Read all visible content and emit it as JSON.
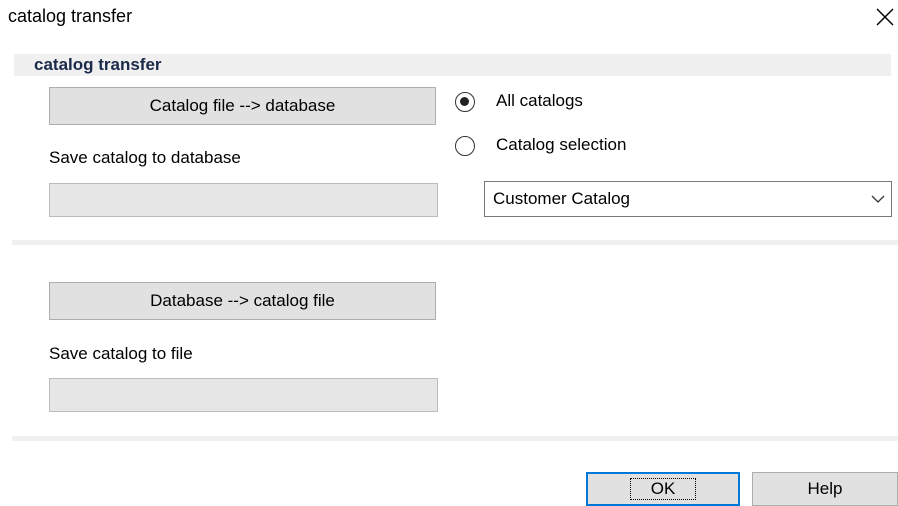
{
  "window": {
    "title": "catalog transfer"
  },
  "group": {
    "label": "catalog transfer"
  },
  "import_section": {
    "button_label": "Catalog file --> database",
    "status_label": "Save catalog to database",
    "progress": 0
  },
  "radio_group": {
    "options": [
      {
        "label": "All catalogs",
        "selected": true
      },
      {
        "label": "Catalog selection",
        "selected": false
      }
    ]
  },
  "catalog_select": {
    "value": "Customer Catalog"
  },
  "export_section": {
    "button_label": "Database --> catalog file",
    "status_label": "Save catalog to file",
    "progress": 0
  },
  "footer": {
    "ok_label": "OK",
    "help_label": "Help"
  },
  "icons": {
    "close": "close-icon",
    "dropdown": "chevron-down-icon"
  }
}
